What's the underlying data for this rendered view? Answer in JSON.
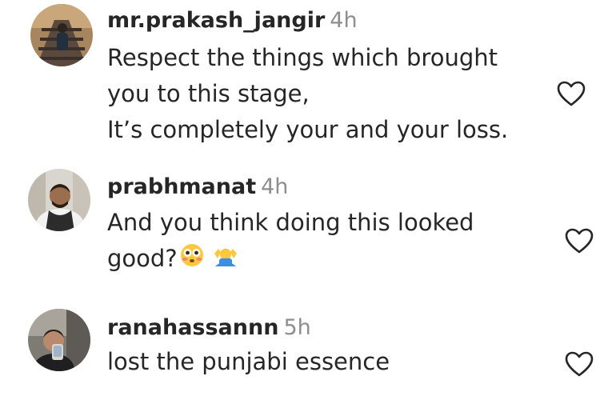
{
  "comments": [
    {
      "username": "mr.prakash_jangir",
      "time": "4h",
      "lines": [
        "Respect the things which brought",
        "you to this stage,",
        "It’s completely your and your loss."
      ],
      "avatar_icon": "profile-photo-person-on-stairs",
      "like_icon": "heart-outline-icon"
    },
    {
      "username": "prabhmanat",
      "time": "4h",
      "lines": [
        "And you think doing this looked",
        "good?"
      ],
      "emojis": [
        "flushed-face-emoji",
        "person-shrugging-emoji"
      ],
      "avatar_icon": "profile-photo-man-in-scarf",
      "like_icon": "heart-outline-icon"
    },
    {
      "username": "ranahassannn",
      "time": "5h",
      "lines": [
        "lost the punjabi essence"
      ],
      "avatar_icon": "profile-photo-mirror-selfie",
      "like_icon": "heart-outline-icon"
    }
  ],
  "colors": {
    "text": "#262626",
    "secondary": "#8e8e8e",
    "heart_stroke": "#262626",
    "background": "#ffffff"
  }
}
